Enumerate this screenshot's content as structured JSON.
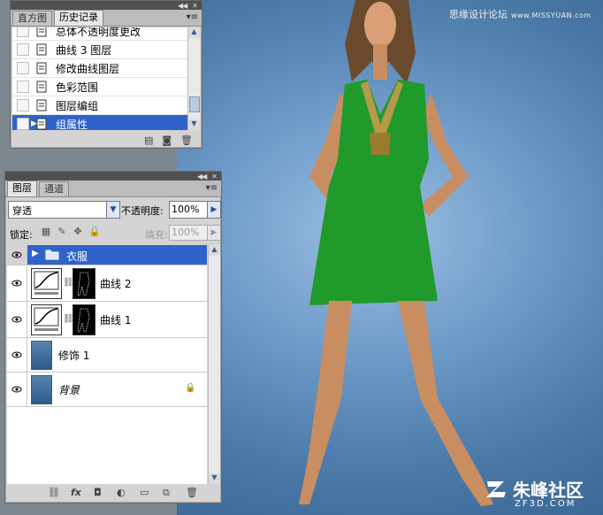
{
  "watermark": {
    "top_cn": "思缘设计论坛",
    "top_latin": "www.MISSYUAN.com",
    "logo_cn": "朱峰社区",
    "logo_en": "ZF3D.COM"
  },
  "history_panel": {
    "tabs": [
      "直方图",
      "历史记录"
    ],
    "active_tab": "历史记录",
    "items": [
      {
        "label": "总体不透明度更改",
        "selected": false
      },
      {
        "label": "曲线 3 图层",
        "selected": false
      },
      {
        "label": "修改曲线图层",
        "selected": false
      },
      {
        "label": "色彩范围",
        "selected": false
      },
      {
        "label": "图层编组",
        "selected": false
      },
      {
        "label": "组属性",
        "selected": true
      }
    ],
    "footer_icons": [
      "new-document-icon",
      "camera-icon",
      "trash-icon"
    ]
  },
  "layers_panel": {
    "tabs": [
      "图层",
      "通道"
    ],
    "active_tab": "图层",
    "blend_mode": "穿透",
    "opacity_label": "不透明度:",
    "opacity_value": "100%",
    "lock_label": "锁定:",
    "fill_label": "填充:",
    "fill_value": "100%",
    "layers": [
      {
        "name": "衣服",
        "type": "group",
        "selected": true,
        "visible": true
      },
      {
        "name": "曲线 2",
        "type": "adjustment",
        "selected": false,
        "visible": true
      },
      {
        "name": "曲线 1",
        "type": "adjustment",
        "selected": false,
        "visible": true
      },
      {
        "name": "修饰 1",
        "type": "image",
        "selected": false,
        "visible": true
      },
      {
        "name": "背景",
        "type": "background",
        "selected": false,
        "visible": true,
        "locked": true
      }
    ],
    "footer_icons": [
      "link-icon",
      "fx-icon",
      "mask-icon",
      "adjustment-icon",
      "folder-icon",
      "new-layer-icon",
      "trash-icon"
    ],
    "footer_fx": "fx"
  },
  "colors": {
    "selection_blue": "#3063c9",
    "panel_gray": "#d4d4d4",
    "dress_green": "#1f9a2b",
    "background_blue": "#4b79a8"
  }
}
